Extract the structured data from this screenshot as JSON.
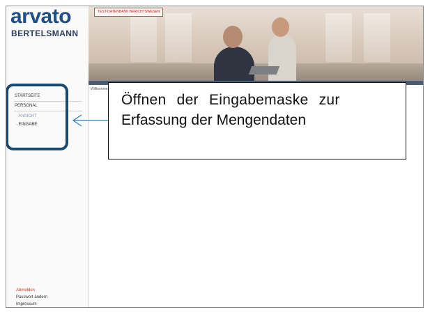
{
  "sidebar": {
    "logo_word": "arvato",
    "logo_sub": "BERTELSMANN",
    "nav_home": "STARTSEITE",
    "nav_section": "PERSONAL",
    "nav_sub_1": "ANSICHT",
    "nav_sub_2": "EINGABE",
    "footer_items": [
      "Abmelden",
      "Passwort ändern",
      "Impressum"
    ]
  },
  "banner": {
    "badge": "TEST-DATENBANK BERICHTSWESEN"
  },
  "content": {
    "label": "Willkommen"
  },
  "callout": {
    "line1": "Öffnen der Eingabemaske zur",
    "line2": "Erfassung der Mengendaten"
  },
  "colors": {
    "brand": "#1f4f87",
    "highlight": "#184a73",
    "connector": "#2c7fb8"
  }
}
